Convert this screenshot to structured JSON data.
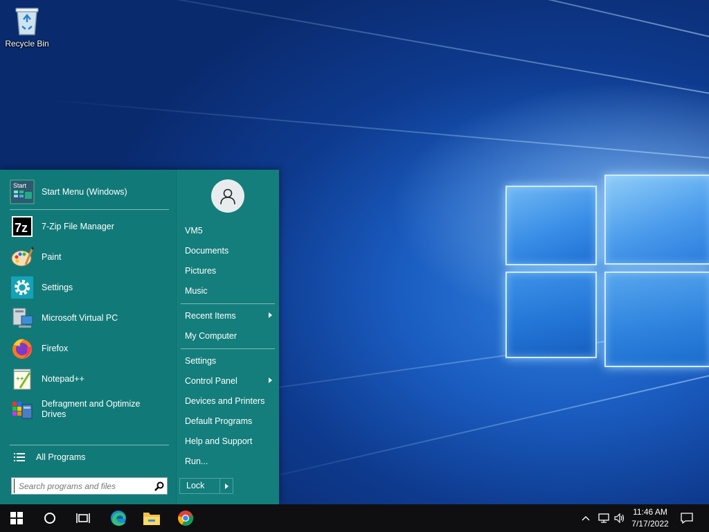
{
  "desktop": {
    "icons": [
      {
        "label": "Recycle Bin",
        "icon": "recycle-bin-icon"
      }
    ]
  },
  "start_menu": {
    "pinned": {
      "label": "Start Menu (Windows)",
      "icon": "start-menu-icon",
      "icon_text": "Start"
    },
    "programs": [
      {
        "label": "7-Zip File Manager",
        "icon": "seven-zip-icon"
      },
      {
        "label": "Paint",
        "icon": "paint-palette-icon"
      },
      {
        "label": "Settings",
        "icon": "gear-icon"
      },
      {
        "label": "Microsoft Virtual PC",
        "icon": "virtual-pc-icon"
      },
      {
        "label": "Firefox",
        "icon": "firefox-icon"
      },
      {
        "label": "Notepad++",
        "icon": "notepad-plus-plus-icon"
      },
      {
        "label": "Defragment and Optimize Drives",
        "icon": "defragment-icon"
      }
    ],
    "all_programs": "All Programs",
    "search_placeholder": "Search programs and files",
    "right": {
      "user": "VM5",
      "items_group1": [
        "Documents",
        "Pictures",
        "Music"
      ],
      "recent_items": "Recent Items",
      "my_computer": "My Computer",
      "settings": "Settings",
      "control_panel": "Control Panel",
      "devices_printers": "Devices and Printers",
      "default_programs": "Default Programs",
      "help_support": "Help and Support",
      "run": "Run...",
      "lock": "Lock"
    }
  },
  "taskbar": {
    "time": "11:46 AM",
    "date": "7/17/2022",
    "apps": [
      "start-windows-icon",
      "cortana-circle-icon",
      "task-view-icon",
      "edge-icon",
      "file-explorer-icon",
      "chrome-icon"
    ],
    "tray": [
      "chevron-up-icon",
      "network-icon",
      "speaker-icon",
      "action-center-icon"
    ]
  },
  "colors": {
    "menu_bg": "#117a78",
    "taskbar_bg": "#0f0f12",
    "wallpaper_blue": "#1a5cc0"
  }
}
